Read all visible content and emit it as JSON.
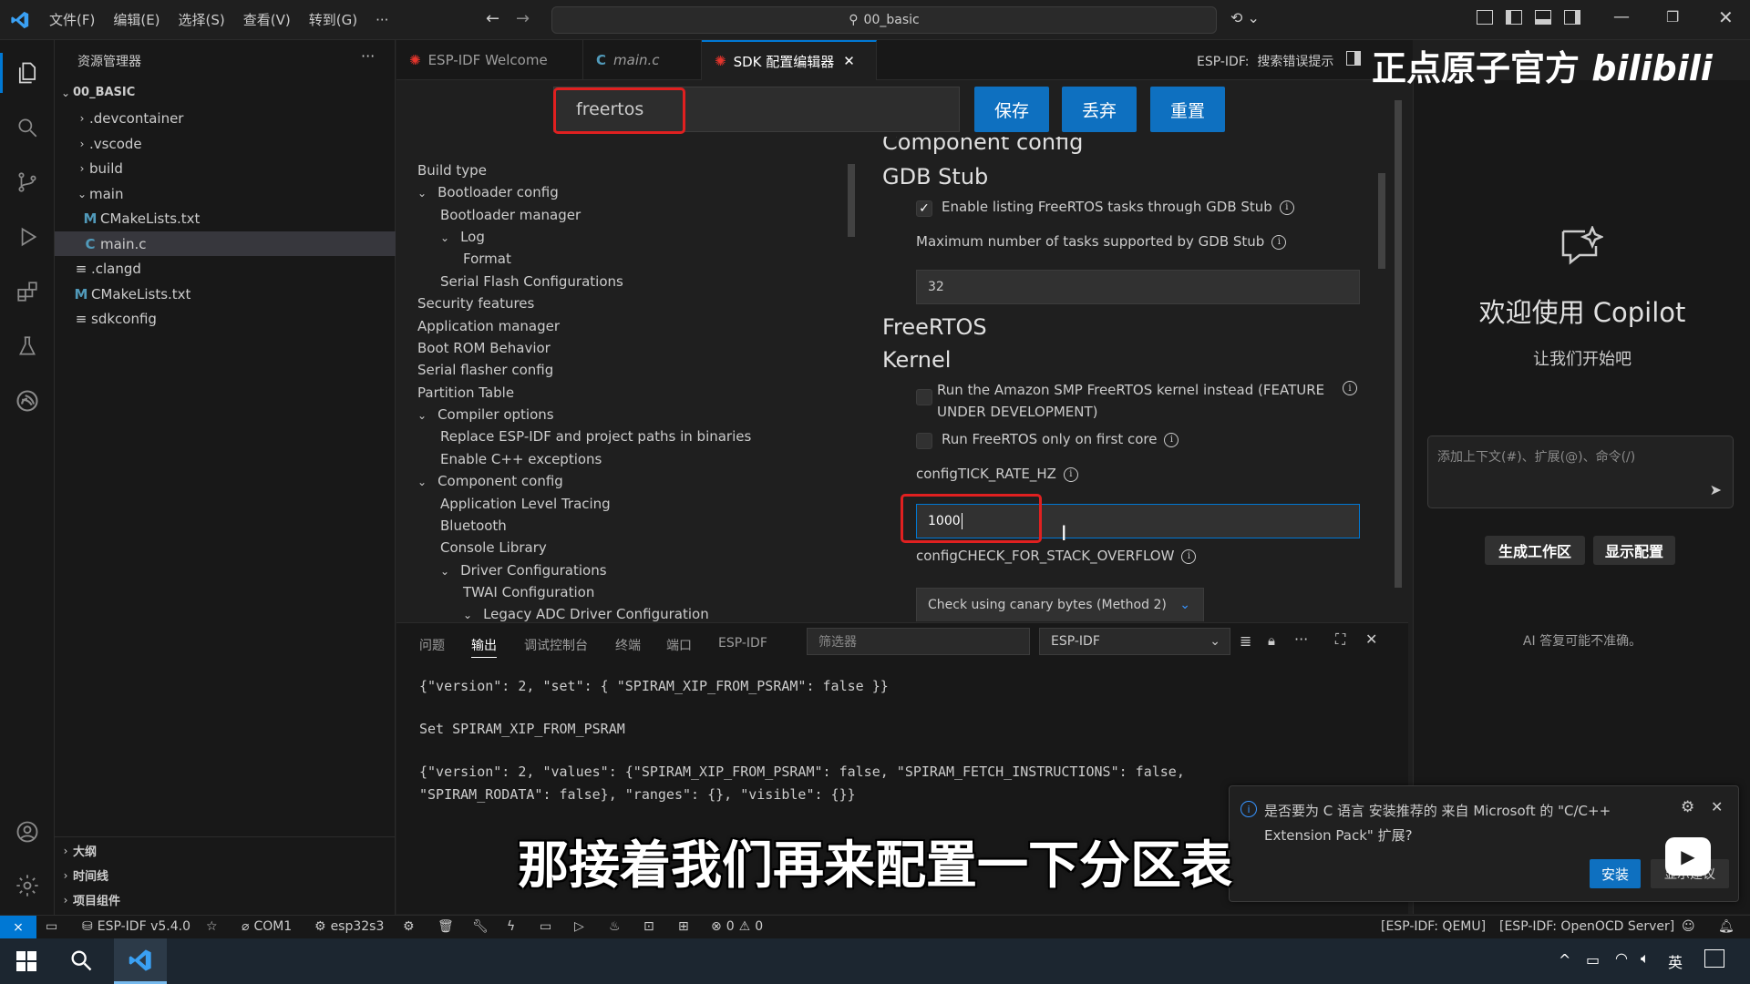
{
  "titlebar": {
    "menus": [
      "文件(F)",
      "编辑(E)",
      "选择(S)",
      "查看(V)",
      "转到(G)",
      "···"
    ],
    "search_text": "00_basic"
  },
  "explorer": {
    "title": "资源管理器",
    "root": "00_BASIC",
    "items": [
      ".devcontainer",
      ".vscode",
      "build",
      "main",
      "CMakeLists.txt",
      "main.c",
      ".clangd",
      "CMakeLists.txt",
      "sdkconfig"
    ],
    "bottom_sections": [
      "大纲",
      "时间线",
      "项目组件"
    ]
  },
  "tabs": [
    {
      "label": "ESP-IDF Welcome"
    },
    {
      "label": "main.c"
    },
    {
      "label": "SDK 配置编辑器"
    }
  ],
  "tabbar_right": "ESP-IDF:  搜索错误提示",
  "sdk": {
    "search_value": "freertos",
    "buttons": {
      "save": "保存",
      "discard": "丢弃",
      "reset": "重置"
    },
    "nav": [
      "Build type",
      "Bootloader config",
      "Bootloader manager",
      "Log",
      "Format",
      "Serial Flash Configurations",
      "Security features",
      "Application manager",
      "Boot ROM Behavior",
      "Serial flasher config",
      "Partition Table",
      "Compiler options",
      "Replace ESP-IDF and project paths in binaries",
      "Enable C++ exceptions",
      "Component config",
      "Application Level Tracing",
      "Bluetooth",
      "Console Library",
      "Driver Configurations",
      "TWAI Configuration",
      "Legacy ADC Driver Configuration"
    ],
    "content": {
      "cut_heading": "Component config",
      "gdb_heading": "GDB Stub",
      "gdb_enable_label": "Enable listing FreeRTOS tasks through GDB Stub",
      "gdb_max_label": "Maximum number of tasks supported by GDB Stub",
      "gdb_max_value": "32",
      "freertos_heading": "FreeRTOS",
      "kernel_heading": "Kernel",
      "smp_label_1": "Run the Amazon SMP FreeRTOS kernel instead (FEATURE",
      "smp_label_2": "UNDER DEVELOPMENT)",
      "first_core_label": "Run FreeRTOS only on first core",
      "tick_label": "configTICK_RATE_HZ",
      "tick_value": "1000",
      "stack_label": "configCHECK_FOR_STACK_OVERFLOW",
      "stack_value": "Check using canary bytes (Method 2)"
    }
  },
  "panel": {
    "tabs": [
      "问题",
      "输出",
      "调试控制台",
      "终端",
      "端口",
      "ESP-IDF"
    ],
    "filter_placeholder": "筛选器",
    "channel": "ESP-IDF",
    "lines": [
      "{\"version\": 2, \"set\": { \"SPIRAM_XIP_FROM_PSRAM\": false }}",
      "Set SPIRAM_XIP_FROM_PSRAM",
      "{\"version\": 2, \"values\": {\"SPIRAM_XIP_FROM_PSRAM\": false, \"SPIRAM_FETCH_INSTRUCTIONS\": false,",
      "\"SPIRAM_RODATA\": false}, \"ranges\": {}, \"visible\": {}}"
    ]
  },
  "copilot": {
    "title": "欢迎使用 Copilot",
    "subtitle": "让我们开始吧",
    "input_placeholder": "添加上下文(#)、扩展(@)、命令(/)",
    "btn_workspace": "生成工作区",
    "btn_config": "显示配置",
    "disclaimer": "AI 答复可能不准确。"
  },
  "notification": {
    "text_1": "是否要为 C 语言 安装推荐的 来自 Microsoft 的 \"C/C++",
    "text_2": "Extension Pack\" 扩展?",
    "install": "安装",
    "show_recommendations": "显示建议"
  },
  "statusbar": {
    "idf_version": "ESP-IDF v5.4.0",
    "port": "COM1",
    "target": "esp32s3",
    "problems": "0",
    "warnings": "0",
    "qemu": "[ESP-IDF: QEMU]",
    "openocd": "[ESP-IDF: OpenOCD Server]"
  },
  "taskbar": {
    "lang": "英"
  },
  "overlay": {
    "subtitle": "那接着我们再来配置一下分区表",
    "watermark": "正点原子官方"
  },
  "colors": {
    "accent_blue": "#0e70c0",
    "highlight_red": "#e02020",
    "background": "#1f1f1f"
  }
}
